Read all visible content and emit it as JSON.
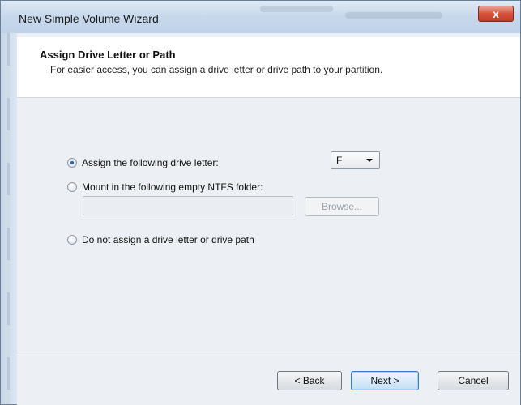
{
  "window": {
    "title": "New Simple Volume Wizard",
    "close_glyph": "x"
  },
  "header": {
    "heading": "Assign Drive Letter or Path",
    "subtext": "For easier access, you can assign a drive letter or drive path to your partition."
  },
  "options": {
    "assign_letter": {
      "label": "Assign the following drive letter:",
      "checked": true
    },
    "mount_folder": {
      "label": "Mount in the following empty NTFS folder:",
      "checked": false
    },
    "no_assign": {
      "label": "Do not assign a drive letter or drive path",
      "checked": false
    }
  },
  "drive_letter": {
    "value": "F"
  },
  "folder_path": {
    "value": ""
  },
  "browse": {
    "label": "Browse..."
  },
  "footer": {
    "back_label": "< Back",
    "next_label": "Next >",
    "cancel_label": "Cancel"
  },
  "colors": {
    "close_button": "#d6523b",
    "default_button_border": "#3a7bd5"
  }
}
